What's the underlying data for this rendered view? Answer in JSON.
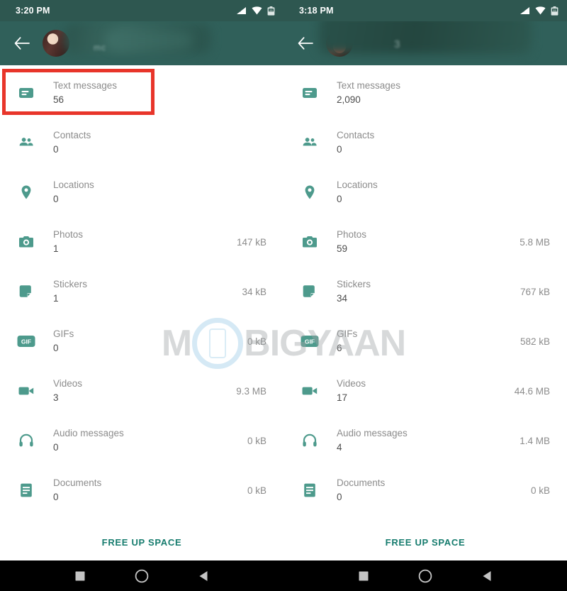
{
  "left_phone": {
    "status_bar": {
      "time": "3:20 PM",
      "icons": [
        "signal-icon",
        "wifi-icon",
        "battery-icon"
      ]
    },
    "app_bar": {
      "back_label": "Back",
      "contact_name_redacted": "mc"
    },
    "rows": [
      {
        "icon": "text-messages-icon",
        "label": "Text messages",
        "count": "56",
        "size": ""
      },
      {
        "icon": "contacts-icon",
        "label": "Contacts",
        "count": "0",
        "size": ""
      },
      {
        "icon": "locations-icon",
        "label": "Locations",
        "count": "0",
        "size": ""
      },
      {
        "icon": "photos-icon",
        "label": "Photos",
        "count": "1",
        "size": "147 kB"
      },
      {
        "icon": "stickers-icon",
        "label": "Stickers",
        "count": "1",
        "size": "34 kB"
      },
      {
        "icon": "gifs-icon",
        "label": "GIFs",
        "count": "0",
        "size": "0 kB"
      },
      {
        "icon": "videos-icon",
        "label": "Videos",
        "count": "3",
        "size": "9.3 MB"
      },
      {
        "icon": "audio-messages-icon",
        "label": "Audio messages",
        "count": "0",
        "size": "0 kB"
      },
      {
        "icon": "documents-icon",
        "label": "Documents",
        "count": "0",
        "size": "0 kB"
      }
    ],
    "footer": {
      "free_up_label": "FREE UP SPACE"
    }
  },
  "right_phone": {
    "status_bar": {
      "time": "3:18 PM",
      "icons": [
        "signal-icon",
        "wifi-icon",
        "battery-icon"
      ]
    },
    "app_bar": {
      "back_label": "Back",
      "contact_name_redacted": "3"
    },
    "rows": [
      {
        "icon": "text-messages-icon",
        "label": "Text messages",
        "count": "2,090",
        "size": ""
      },
      {
        "icon": "contacts-icon",
        "label": "Contacts",
        "count": "0",
        "size": ""
      },
      {
        "icon": "locations-icon",
        "label": "Locations",
        "count": "0",
        "size": ""
      },
      {
        "icon": "photos-icon",
        "label": "Photos",
        "count": "59",
        "size": "5.8 MB"
      },
      {
        "icon": "stickers-icon",
        "label": "Stickers",
        "count": "34",
        "size": "767 kB"
      },
      {
        "icon": "gifs-icon",
        "label": "GIFs",
        "count": "6",
        "size": "582 kB"
      },
      {
        "icon": "videos-icon",
        "label": "Videos",
        "count": "17",
        "size": "44.6 MB"
      },
      {
        "icon": "audio-messages-icon",
        "label": "Audio messages",
        "count": "4",
        "size": "1.4 MB"
      },
      {
        "icon": "documents-icon",
        "label": "Documents",
        "count": "0",
        "size": "0 kB"
      }
    ],
    "footer": {
      "free_up_label": "FREE UP SPACE"
    }
  },
  "nav_bar": {
    "buttons": [
      "recents-square-icon",
      "home-circle-icon",
      "back-triangle-icon"
    ]
  },
  "watermark": {
    "text_before": "M",
    "text_after": "BIGYAAN"
  },
  "annotation": {
    "highlight_color": "#e8352a",
    "highlight_target": "Text messages"
  },
  "colors": {
    "status_bar": "#2e5750",
    "app_bar": "#30605a",
    "accent_teal": "#4d9a8c",
    "link_teal": "#167c6e",
    "label_gray": "#8c8c8c",
    "value_gray": "#4d4d4d"
  }
}
